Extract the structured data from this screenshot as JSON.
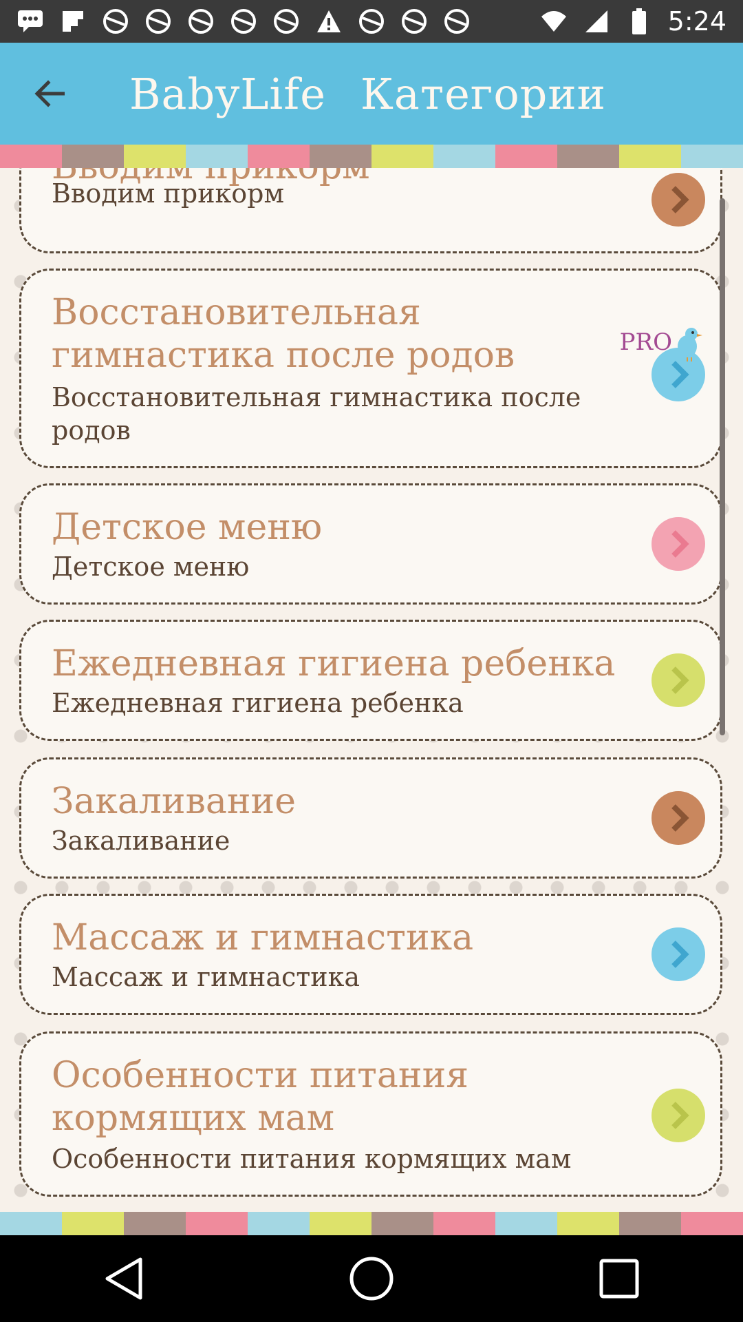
{
  "status_bar": {
    "time": "5:24",
    "icons": [
      "message-icon",
      "flipboard-icon",
      "soccer-icon",
      "soccer-icon",
      "soccer-icon",
      "soccer-icon",
      "soccer-icon",
      "warning-icon",
      "soccer-icon",
      "soccer-icon",
      "soccer-icon",
      "soccer-icon"
    ]
  },
  "app_bar": {
    "title": "BabyLife",
    "subtitle": "Категории"
  },
  "stripe_colors": [
    "#ef8b9c",
    "#a99088",
    "#dde26b",
    "#a4d7e3",
    "#ef8b9c",
    "#a99088",
    "#dde26b",
    "#a4d7e3",
    "#ef8b9c",
    "#a99088",
    "#dde26b",
    "#a4d7e3"
  ],
  "categories": [
    {
      "title": "Вводим прикорм",
      "subtitle": "Вводим прикорм",
      "color": "#c9875e"
    },
    {
      "title": "Восстановительная гимнастика после родов",
      "subtitle": "Восстановительная гимнастика после родов",
      "color": "#7ccde8",
      "badge": "PRO"
    },
    {
      "title": "Детское меню",
      "subtitle": "Детское меню",
      "color": "#f3a3b2"
    },
    {
      "title": "Ежедневная гигиена ребенка",
      "subtitle": "Ежедневная гигиена ребенка",
      "color": "#d6df6c"
    },
    {
      "title": "Закаливание",
      "subtitle": "Закаливание",
      "color": "#c9875e"
    },
    {
      "title": "Массаж и гимнастика",
      "subtitle": "Массаж и гимнастика",
      "color": "#7ccde8"
    },
    {
      "title": "Особенности питания кормящих мам",
      "subtitle": "Особенности питания кормящих мам",
      "color": "#d6df6c"
    }
  ]
}
